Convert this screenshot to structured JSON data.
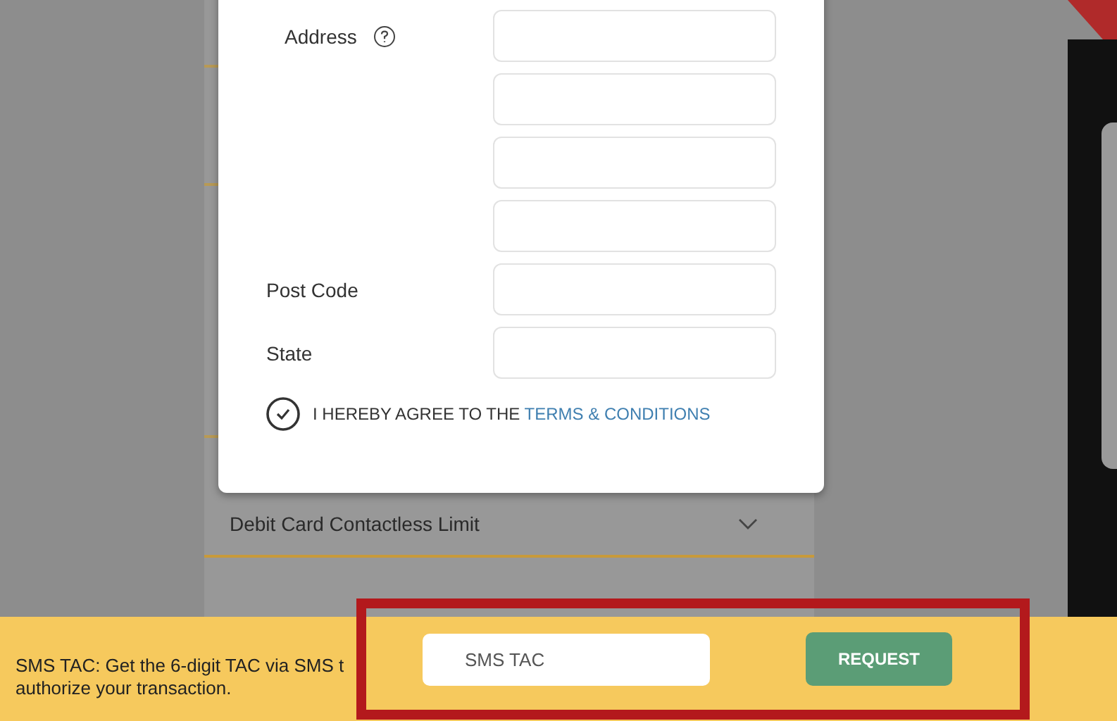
{
  "form": {
    "fields": [
      {
        "label": "Address",
        "help": true
      },
      {
        "help": false
      },
      {
        "help": false
      },
      {
        "help": false
      },
      {
        "label": "Post Code",
        "help": false
      },
      {
        "label": "State",
        "help": false
      }
    ],
    "agreement": {
      "checked": true,
      "text": "I HEREBY AGREE TO THE ",
      "link": "TERMS & CONDITIONS"
    }
  },
  "section": {
    "title": "Debit Card Contactless Limit",
    "expanded": false
  },
  "tac_bar": {
    "text_lines": [
      "SMS TAC: Get the 6-digit TAC via SMS t",
      "authorize your transaction."
    ],
    "placeholder": "SMS TAC",
    "button": "REQUEST"
  }
}
